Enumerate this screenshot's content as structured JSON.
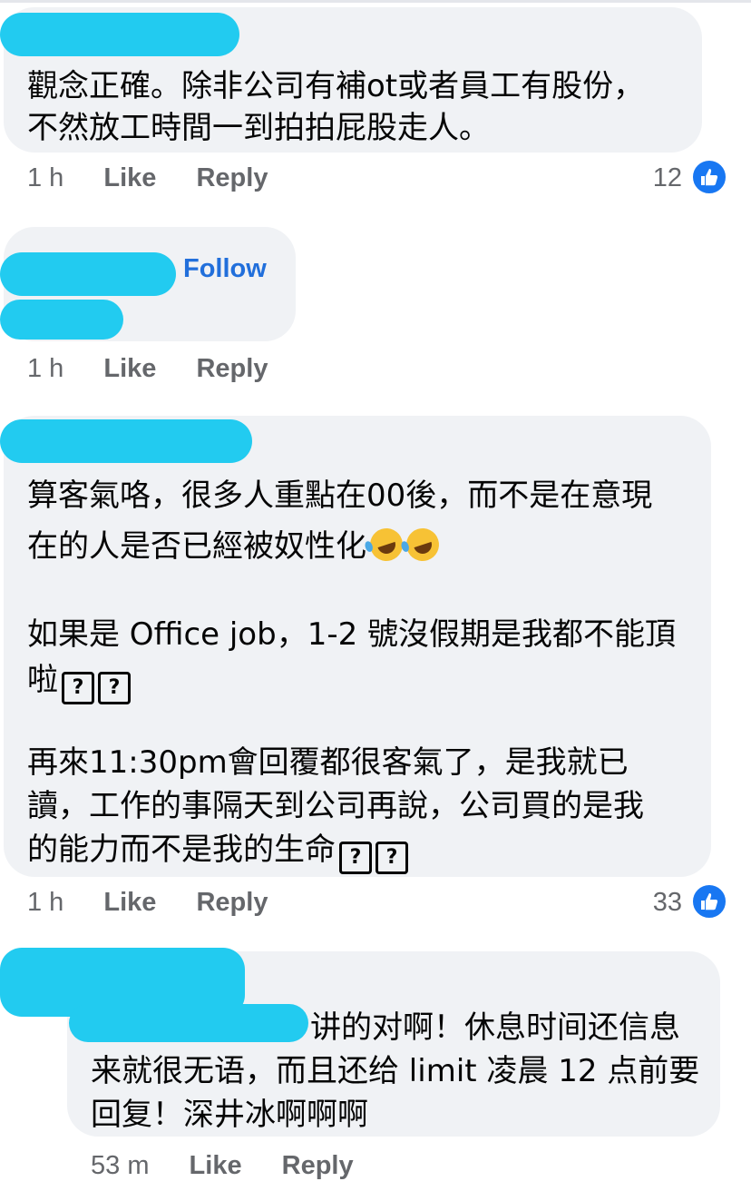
{
  "comments": [
    {
      "lines": [
        "觀念正確。除非公司有補ot或者員工有股份，",
        "不然放工時間一到拍拍屁股走人。"
      ],
      "time": "1 h",
      "like": "Like",
      "reply": "Reply",
      "count": "12"
    },
    {
      "follow": "Follow",
      "time": "1 h",
      "like": "Like",
      "reply": "Reply"
    },
    {
      "p1_line1": "算客氣咯，很多人重點在00後，而不是在意現",
      "p1_line2": "在的人是否已經被奴性化",
      "p2_line1": "如果是 Office job，1-2 號沒假期是我都不能頂",
      "p2_line2": "啦",
      "p3_line1": "再來11:30pm會回覆都很客氣了，是我就已",
      "p3_line2": "讀，工作的事隔天到公司再說，公司買的是我",
      "p3_line3": "的能力而不是我的生命",
      "time": "1 h",
      "like": "Like",
      "reply": "Reply",
      "count": "33"
    },
    {
      "line1": "讲的对啊！休息时间还信息",
      "line2": "来就很无语，而且还给 limit 凌晨 12 点前要",
      "line3": "回复！深井冰啊啊啊",
      "time": "53 m",
      "like": "Like",
      "reply": "Reply"
    }
  ],
  "glyphs": {
    "missing": "?",
    "emoji": "rolling-on-floor-laughing"
  },
  "colors": {
    "bubble": "#f0f2f5",
    "redaction": "#22cbf0",
    "link": "#216fdb",
    "meta": "#65676b",
    "like_blue": "#1877f2"
  }
}
